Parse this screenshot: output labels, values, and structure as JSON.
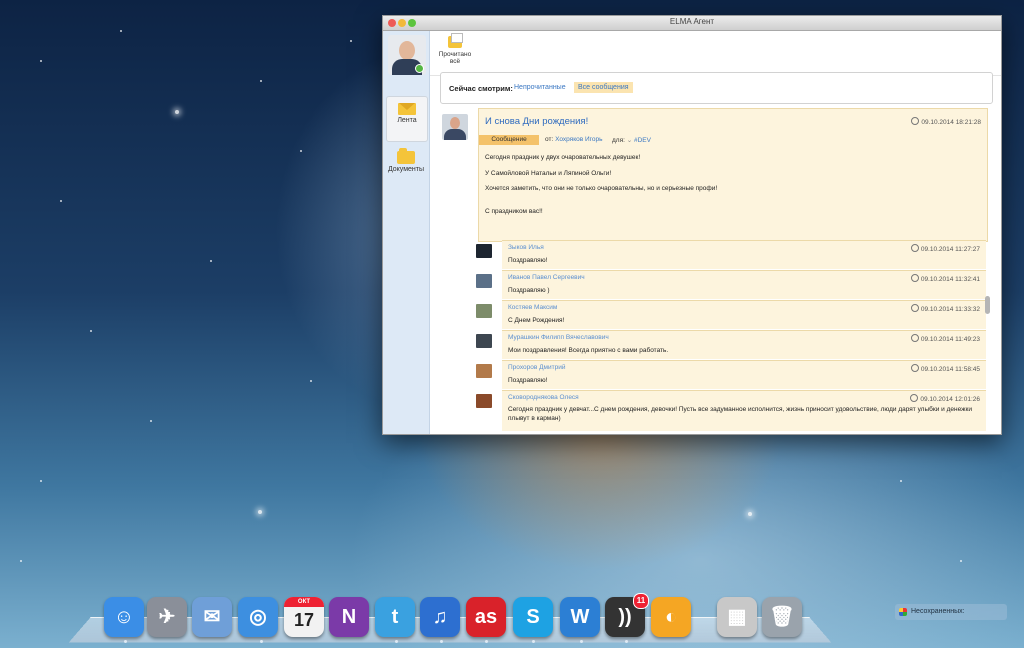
{
  "window": {
    "title": "ELMA Агент"
  },
  "sidebar": {
    "items": [
      {
        "label": "Лента",
        "icon": "envelope-icon"
      },
      {
        "label": "Документы",
        "icon": "folder-icon"
      }
    ]
  },
  "toolbar": {
    "read_all_label": "Прочитано всё"
  },
  "filter": {
    "label": "Сейчас смотрим:",
    "unread": "Непрочитанные",
    "all": "Все сообщения"
  },
  "post": {
    "title": "И снова Дни рождения!",
    "timestamp": "09.10.2014 18:21:28",
    "type_tag": "Сообщение",
    "from_label": "от:",
    "author": "Хохряков Игорь",
    "for_label": "для:",
    "for_value": "#DEV",
    "lines": [
      "Сегодня праздник у двух очаровательных девушек!",
      "У Самойловой Натальи и Ляпиной Ольги!",
      "Хочется заметить, что они не только очаровательны, но и серьезные профи!",
      "С праздником вас!!"
    ]
  },
  "comments": [
    {
      "name": "Зыков Илья",
      "text": "Поздравляю!",
      "time": "09.10.2014 11:27:27"
    },
    {
      "name": "Иванов Павел Сергеевич",
      "text": "Поздравляю )",
      "time": "09.10.2014 11:32:41"
    },
    {
      "name": "Костяев Максим",
      "text": "С Днем Рождения!",
      "time": "09.10.2014 11:33:32"
    },
    {
      "name": "Мурашкин Филипп Вячеславович",
      "text": "Мои поздравления! Всегда приятно с вами работать.",
      "time": "09.10.2014 11:49:23"
    },
    {
      "name": "Прохоров Дмитрий",
      "text": "Поздравляю!",
      "time": "09.10.2014 11:58:45"
    },
    {
      "name": "Сковороднякова Олеся",
      "text": "Сегодня праздник у девчат...С днем рождения, девочки! Пусть все задуманное исполнится, жизнь приносит удовольствие, люди дарят улыбки и денежки плывут в карман)",
      "time": "09.10.2014 12:01:26"
    }
  ],
  "dock": {
    "items": [
      {
        "name": "finder",
        "color": "#3b8ee6",
        "glyph": "☺"
      },
      {
        "name": "launchpad",
        "color": "#8a8f99",
        "glyph": "✈"
      },
      {
        "name": "mail",
        "color": "#6f9fd8",
        "glyph": "✉"
      },
      {
        "name": "safari",
        "color": "#3d8fe0",
        "glyph": "◎"
      },
      {
        "name": "calendar",
        "color": "#f2f2f2",
        "glyph": "17",
        "month": "ОКТ"
      },
      {
        "name": "onenote",
        "color": "#7b3aa8",
        "glyph": "N"
      },
      {
        "name": "twitter",
        "color": "#3aa1e0",
        "glyph": "t"
      },
      {
        "name": "itunes",
        "color": "#2d6fd0",
        "glyph": "♫"
      },
      {
        "name": "lastfm",
        "color": "#d9222a",
        "glyph": "as"
      },
      {
        "name": "skype",
        "color": "#1ea2e3",
        "glyph": "S"
      },
      {
        "name": "wunderlist",
        "color": "#2c7fd4",
        "glyph": "W"
      },
      {
        "name": "rss-reader",
        "color": "#333333",
        "glyph": "))",
        "badge": "11"
      },
      {
        "name": "app-colorful",
        "color": "#f5a623",
        "glyph": "◐"
      },
      {
        "name": "preview",
        "color": "#c8c8c8",
        "glyph": "▦"
      },
      {
        "name": "trash",
        "color": "#9aa3ac",
        "glyph": "🗑"
      }
    ]
  },
  "notification": {
    "label": "Несохраненных:"
  }
}
